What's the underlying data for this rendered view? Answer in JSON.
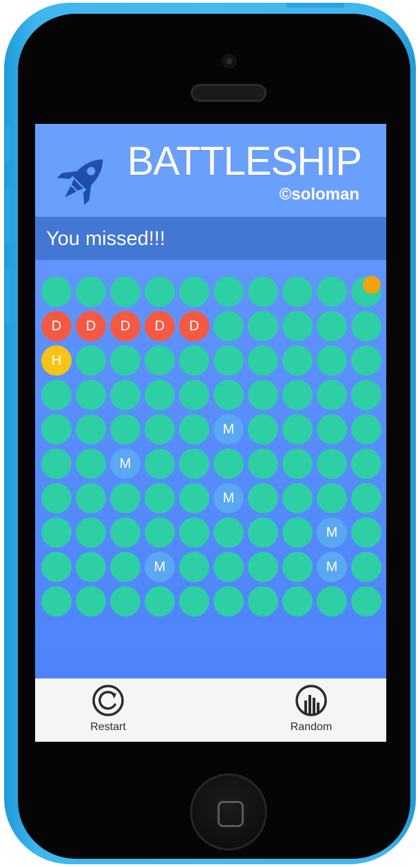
{
  "app": {
    "title": "BATTLESHIP",
    "author": "©soloman",
    "logo_icon": "rocket-icon"
  },
  "status": {
    "message": "You missed!!!"
  },
  "colors": {
    "header": "#6aa0fd",
    "status_bar": "#4377d4",
    "cell_empty": "#2ecfa4",
    "cell_miss": "#5aa7f2",
    "cell_destroyed": "#f45a43",
    "cell_hit": "#f6c316",
    "last_shot_marker": "#f2a20e",
    "phone_case": "#45bbf1"
  },
  "board": {
    "rows": 10,
    "cols": 10,
    "last_shot": {
      "row": 0,
      "col": 9
    },
    "cells": [
      [
        "",
        "",
        "",
        "",
        "",
        "",
        "",
        "",
        "",
        ""
      ],
      [
        "D",
        "D",
        "D",
        "D",
        "D",
        "",
        "",
        "",
        "",
        ""
      ],
      [
        "H",
        "",
        "",
        "",
        "",
        "",
        "",
        "",
        "",
        ""
      ],
      [
        "",
        "",
        "",
        "",
        "",
        "",
        "",
        "",
        "",
        ""
      ],
      [
        "",
        "",
        "",
        "",
        "",
        "M",
        "",
        "",
        "",
        ""
      ],
      [
        "",
        "",
        "M",
        "",
        "",
        "",
        "",
        "",
        "",
        ""
      ],
      [
        "",
        "",
        "",
        "",
        "",
        "M",
        "",
        "",
        "",
        ""
      ],
      [
        "",
        "",
        "",
        "",
        "",
        "",
        "",
        "",
        "M",
        ""
      ],
      [
        "",
        "",
        "",
        "M",
        "",
        "",
        "",
        "",
        "M",
        ""
      ],
      [
        "",
        "",
        "",
        "",
        "",
        "",
        "",
        "",
        "",
        ""
      ]
    ]
  },
  "toolbar": {
    "restart_label": "Restart",
    "restart_icon": "restart-icon",
    "random_label": "Random",
    "random_icon": "random-icon"
  }
}
